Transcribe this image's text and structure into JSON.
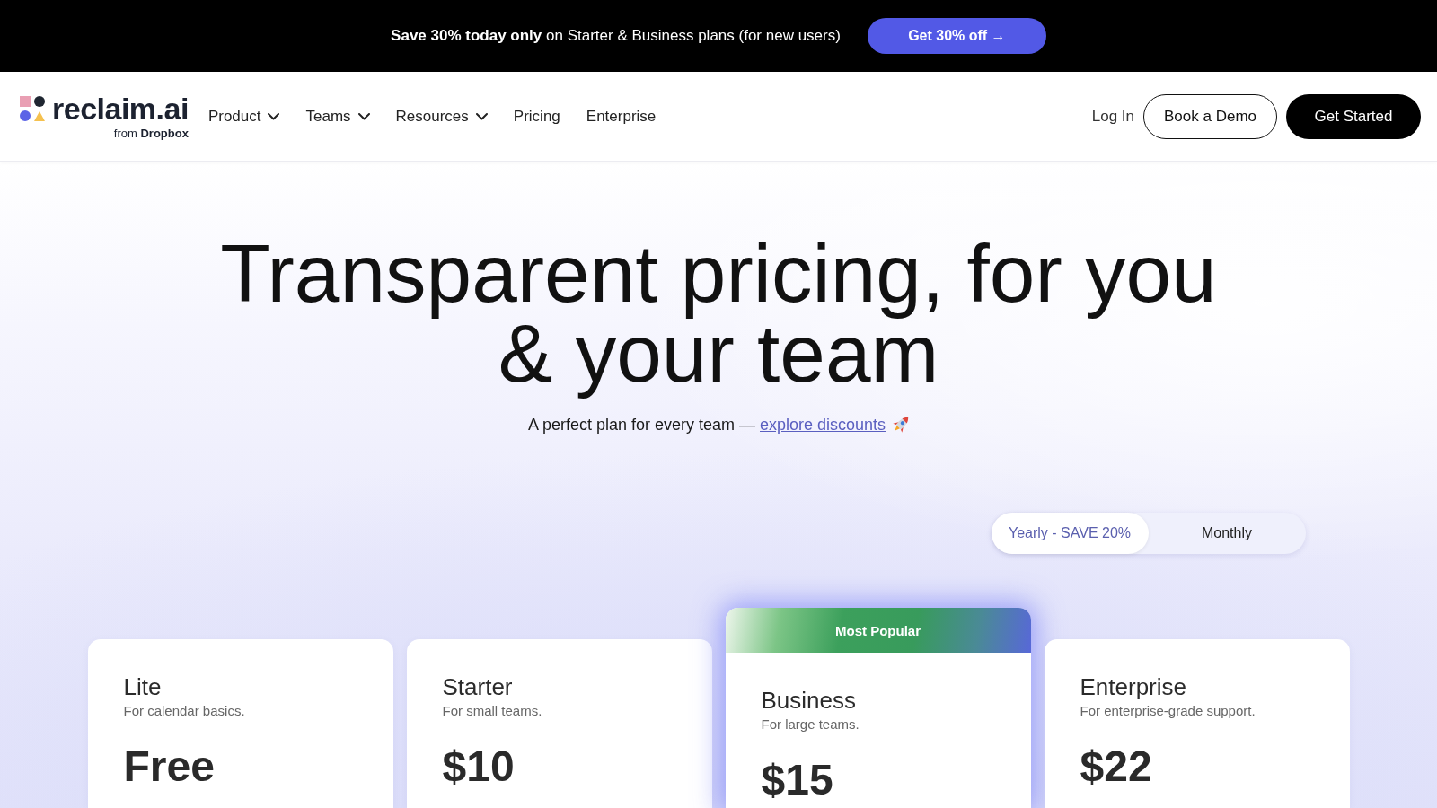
{
  "promo_banner": {
    "text": "**Save 30% today only** on Starter & Business plans (for new users)",
    "button": "Get 30% off →"
  },
  "nav": {
    "logo": {
      "wordmark": "reclaim.ai",
      "tagline": "from **Dropbox**"
    },
    "items": [
      {
        "label": "Product",
        "has_menu": true
      },
      {
        "label": "Teams",
        "has_menu": true
      },
      {
        "label": "Resources",
        "has_menu": true
      },
      {
        "label": "Pricing",
        "has_menu": false
      },
      {
        "label": "Enterprise",
        "has_menu": false
      }
    ],
    "actions": [
      {
        "label": "Log In",
        "kind": "link"
      },
      {
        "label": "Book a Demo",
        "kind": "outline"
      },
      {
        "label": "Get Started",
        "kind": "primary"
      }
    ]
  },
  "hero": {
    "title": "Transparent pricing, for you & your team",
    "subtitle": "A perfect plan for every team —",
    "link": "explore discounts"
  },
  "billing_toggle": [
    {
      "label": "Yearly - SAVE 20%",
      "selected": true
    },
    {
      "label": "Monthly",
      "selected": false
    }
  ],
  "plans": [
    {
      "name": "Lite",
      "description": "For calendar basics.",
      "price": "Free",
      "featured": false
    },
    {
      "name": "Starter",
      "description": "For small teams.",
      "price": "$10",
      "featured": false
    },
    {
      "name": "Business",
      "description": "For large teams.",
      "price": "$15",
      "featured": true,
      "badge": "Most Popular"
    },
    {
      "name": "Enterprise",
      "description": "For enterprise-grade support.",
      "price": "$22",
      "featured": false
    }
  ]
}
